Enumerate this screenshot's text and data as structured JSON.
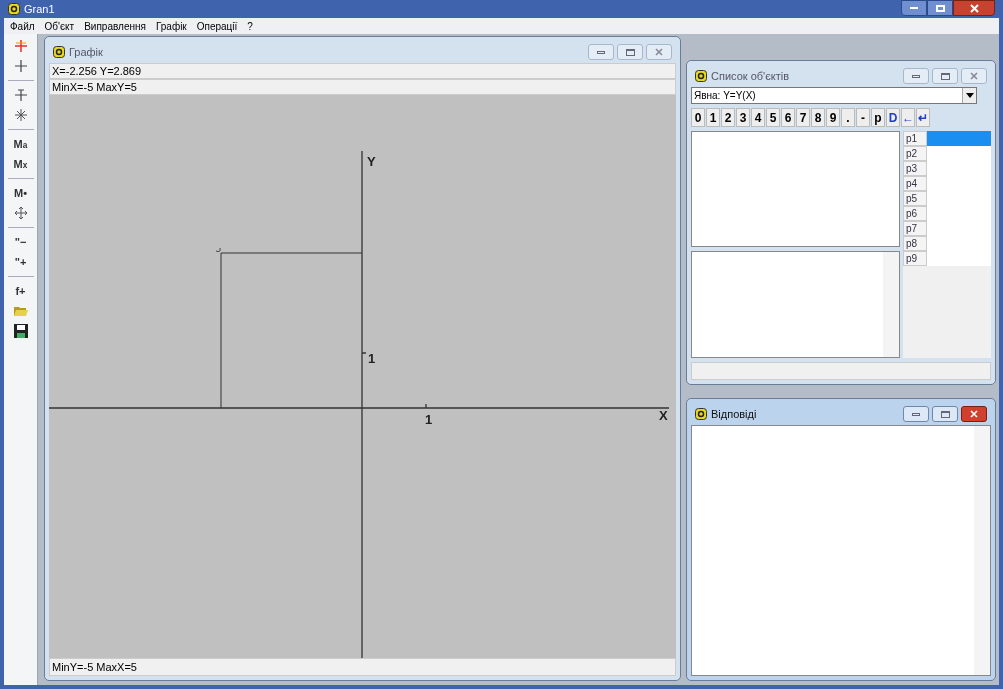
{
  "window": {
    "title": "Gran1"
  },
  "menu": [
    "Файл",
    "Об'єкт",
    "Виправлення",
    "Графік",
    "Операції",
    "?"
  ],
  "tools": [
    {
      "kind": "redcross"
    },
    {
      "kind": "cross"
    },
    {
      "kind": "separator"
    },
    {
      "kind": "crosstick"
    },
    {
      "kind": "star"
    },
    {
      "kind": "separator"
    },
    {
      "kind": "label",
      "label": "M$_{a}$"
    },
    {
      "kind": "label",
      "label": "M$_{x}$"
    },
    {
      "kind": "separator"
    },
    {
      "kind": "label",
      "label": "M•"
    },
    {
      "kind": "move"
    },
    {
      "kind": "separator"
    },
    {
      "kind": "label",
      "label": "\"−"
    },
    {
      "kind": "label",
      "label": "\"+"
    },
    {
      "kind": "separator"
    },
    {
      "kind": "label",
      "label": "f+"
    },
    {
      "kind": "folder"
    },
    {
      "kind": "disk"
    }
  ],
  "graph_window": {
    "title": "Графік",
    "active": false,
    "cursor": "X=-2.256 Y=2.869",
    "limits_top": "MinX=-5 MaxY=5",
    "limits_bottom": "MinY=-5 MaxX=5",
    "plot": {
      "y_axis_label": "Y",
      "x_axis_label": "X",
      "x_tick_label": "1",
      "y_tick_label": "1"
    }
  },
  "objects_window": {
    "title": "Список об'єктів",
    "active": false,
    "function_type": "Явна: Y=Y(X)",
    "keypad": [
      {
        "label": "0",
        "kind": "digit"
      },
      {
        "label": "1",
        "kind": "digit"
      },
      {
        "label": "2",
        "kind": "digit"
      },
      {
        "label": "3",
        "kind": "digit"
      },
      {
        "label": "4",
        "kind": "digit"
      },
      {
        "label": "5",
        "kind": "digit"
      },
      {
        "label": "6",
        "kind": "digit"
      },
      {
        "label": "7",
        "kind": "digit"
      },
      {
        "label": "8",
        "kind": "digit"
      },
      {
        "label": "9",
        "kind": "digit"
      },
      {
        "label": ".",
        "kind": "digit"
      },
      {
        "label": "-",
        "kind": "digit"
      },
      {
        "label": "p",
        "kind": "digit"
      },
      {
        "label": "D",
        "kind": "command"
      },
      {
        "label": "←",
        "kind": "command"
      },
      {
        "label": "↵",
        "kind": "command"
      }
    ],
    "parameters": [
      {
        "label": "p1",
        "selected": true
      },
      {
        "label": "p2",
        "selected": false
      },
      {
        "label": "p3",
        "selected": false
      },
      {
        "label": "p4",
        "selected": false
      },
      {
        "label": "p5",
        "selected": false
      },
      {
        "label": "p6",
        "selected": false
      },
      {
        "label": "p7",
        "selected": false
      },
      {
        "label": "p8",
        "selected": false
      },
      {
        "label": "p9",
        "selected": false
      }
    ]
  },
  "answers_window": {
    "title": "Відповіді",
    "active": true
  }
}
